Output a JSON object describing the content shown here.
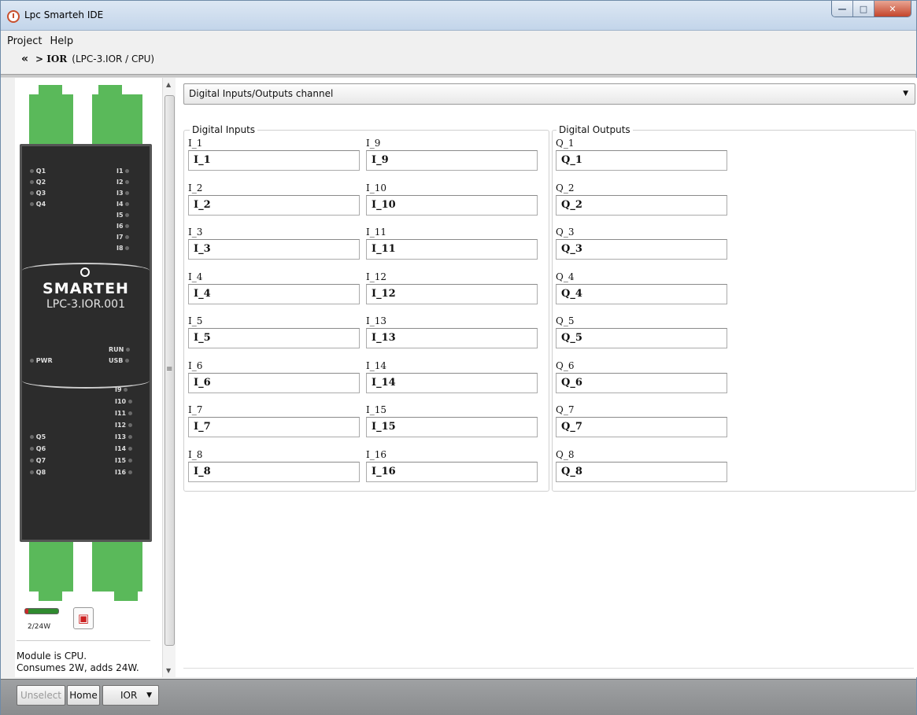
{
  "window": {
    "title": "Lpc Smarteh IDE"
  },
  "menu": [
    "Project",
    "Help"
  ],
  "breadcrumb": {
    "main": "> IOR",
    "detail": "(LPC-3.IOR / CPU)"
  },
  "device": {
    "brand": "SMARTEH",
    "model": "LPC-3.IOR.001",
    "leds_left_top": [
      "Q1",
      "Q2",
      "Q3",
      "Q4"
    ],
    "leds_right_top": [
      "I1",
      "I2",
      "I3",
      "I4",
      "I5",
      "I6",
      "I7",
      "I8"
    ],
    "led_run": "RUN",
    "led_usb": "USB",
    "led_pwr": "PWR",
    "leds_right_bottom": [
      "I9",
      "I10",
      "I11",
      "I12",
      "I13",
      "I14",
      "I15",
      "I16"
    ],
    "leds_left_bottom": [
      "Q5",
      "Q6",
      "Q7",
      "Q8"
    ]
  },
  "power": {
    "label": "2/24W",
    "level": 0.08
  },
  "status": {
    "line1": "Module is CPU.",
    "line2": "Consumes 2W, adds 24W."
  },
  "channel_select": {
    "value": "Digital Inputs/Outputs channel"
  },
  "digital_inputs": {
    "title": "Digital Inputs",
    "col1": [
      {
        "label": "I_1",
        "value": "I_1"
      },
      {
        "label": "I_2",
        "value": "I_2"
      },
      {
        "label": "I_3",
        "value": "I_3"
      },
      {
        "label": "I_4",
        "value": "I_4"
      },
      {
        "label": "I_5",
        "value": "I_5"
      },
      {
        "label": "I_6",
        "value": "I_6"
      },
      {
        "label": "I_7",
        "value": "I_7"
      },
      {
        "label": "I_8",
        "value": "I_8"
      }
    ],
    "col2": [
      {
        "label": "I_9",
        "value": "I_9"
      },
      {
        "label": "I_10",
        "value": "I_10"
      },
      {
        "label": "I_11",
        "value": "I_11"
      },
      {
        "label": "I_12",
        "value": "I_12"
      },
      {
        "label": "I_13",
        "value": "I_13"
      },
      {
        "label": "I_14",
        "value": "I_14"
      },
      {
        "label": "I_15",
        "value": "I_15"
      },
      {
        "label": "I_16",
        "value": "I_16"
      }
    ]
  },
  "digital_outputs": {
    "title": "Digital Outputs",
    "col1": [
      {
        "label": "Q_1",
        "value": "Q_1"
      },
      {
        "label": "Q_2",
        "value": "Q_2"
      },
      {
        "label": "Q_3",
        "value": "Q_3"
      },
      {
        "label": "Q_4",
        "value": "Q_4"
      },
      {
        "label": "Q_5",
        "value": "Q_5"
      },
      {
        "label": "Q_6",
        "value": "Q_6"
      },
      {
        "label": "Q_7",
        "value": "Q_7"
      },
      {
        "label": "Q_8",
        "value": "Q_8"
      }
    ]
  },
  "footer": {
    "unselect": "Unselect",
    "home": "Home",
    "ior": "IOR"
  }
}
